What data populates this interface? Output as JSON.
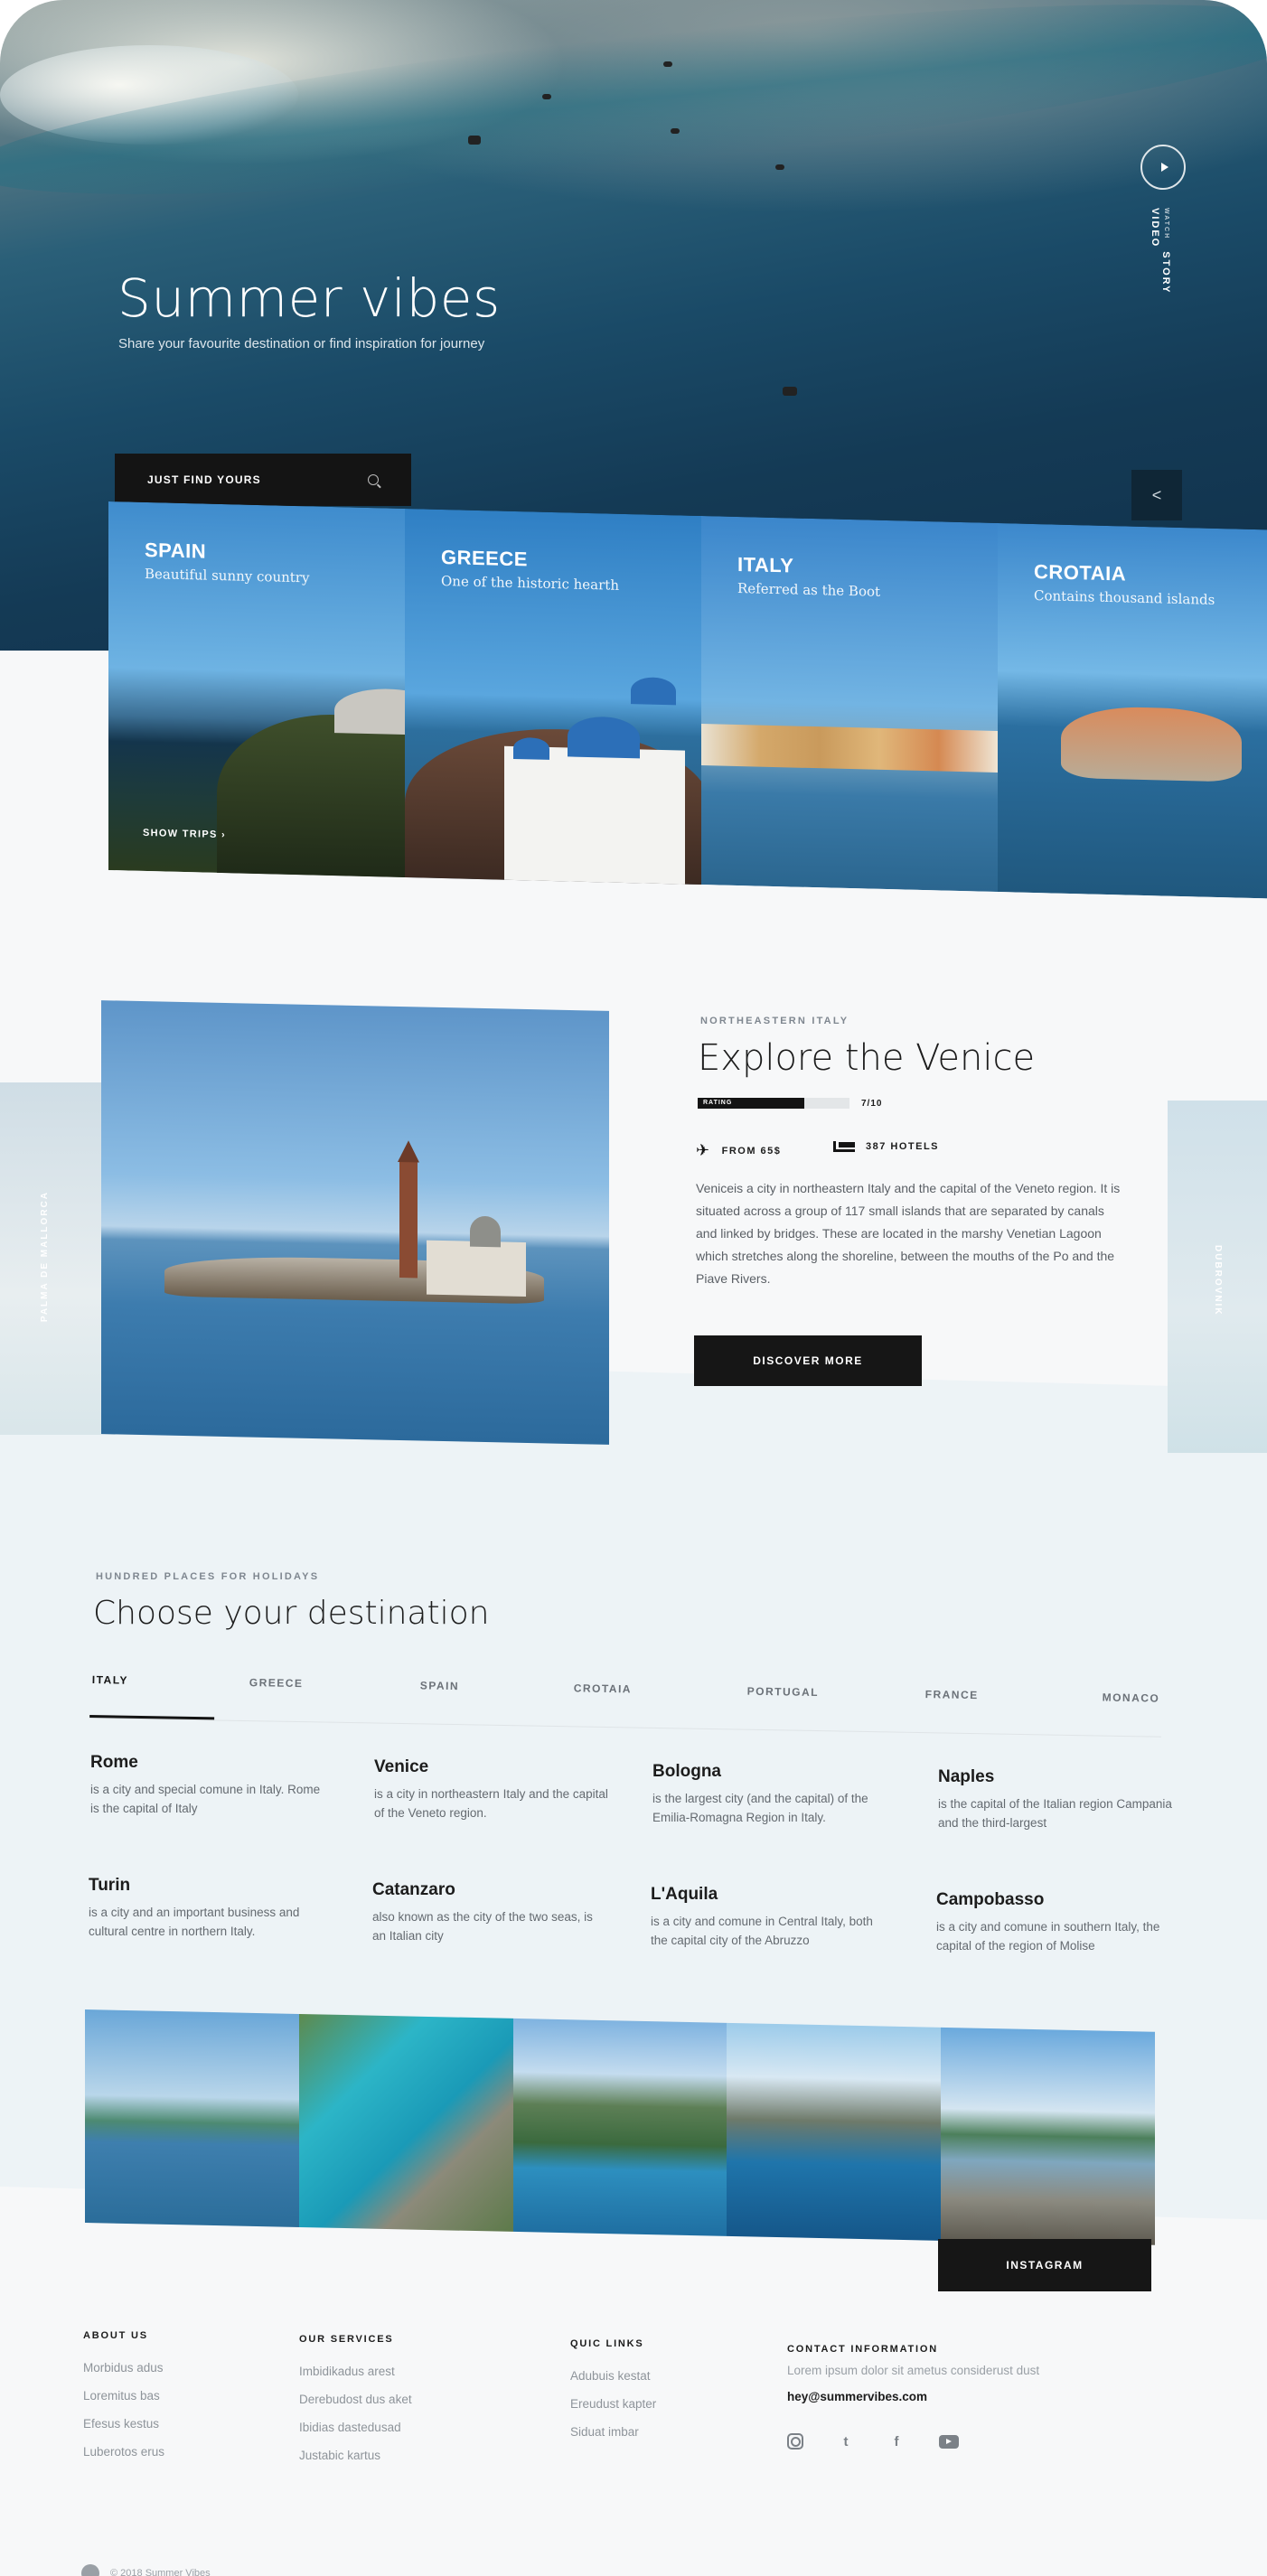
{
  "hero": {
    "title": "Summer vibes",
    "subtitle": "Share your favourite destination or find inspiration for journey",
    "story_small": "WATCH",
    "story_label": "STORY VIDEO",
    "search_label": "JUST FIND YOURS"
  },
  "cards": [
    {
      "name": "SPAIN",
      "tagline": "Beautiful sunny country",
      "action": "SHOW TRIPS"
    },
    {
      "name": "GREECE",
      "tagline": "One of the historic hearth"
    },
    {
      "name": "ITALY",
      "tagline": "Referred as the Boot"
    },
    {
      "name": "CROTAIA",
      "tagline": "Contains thousand islands"
    }
  ],
  "explore": {
    "kicker": "NORTHEASTERN ITALY",
    "title": "Explore the Venice",
    "rating_label": "RATING",
    "rating_value": "7/10",
    "rating_fraction": 0.7,
    "price": "FROM 65$",
    "hotels": "387 HOTELS",
    "body": "Veniceis a city in northeastern Italy and the capital of the Veneto region. It is situated across a group of 117 small islands that are separated by canals and linked by bridges. These are located in the marshy Venetian Lagoon which stretches along the shoreline, between the mouths of the Po and the Piave Rivers.",
    "button": "DISCOVER MORE",
    "side_left": "PALMA DE MALLORCA",
    "side_right": "DUBROVNIK"
  },
  "destinations": {
    "kicker": "HUNDRED PLACES FOR HOLIDAYS",
    "title": "Choose your destination",
    "tabs": [
      "ITALY",
      "GREECE",
      "SPAIN",
      "CROTAIA",
      "PORTUGAL",
      "FRANCE",
      "MONACO"
    ],
    "cities": [
      {
        "name": "Rome",
        "desc": "is a city and special comune in Italy. Rome is the capital of Italy"
      },
      {
        "name": "Venice",
        "desc": "is a city in northeastern Italy and the capital of the Veneto region."
      },
      {
        "name": "Bologna",
        "desc": "is the largest city (and the capital) of the Emilia-Romagna Region in Italy."
      },
      {
        "name": "Naples",
        "desc": "is the capital of the Italian region Campania and the third-largest"
      },
      {
        "name": "Turin",
        "desc": "is a city and an important business and cultural centre in northern Italy."
      },
      {
        "name": "Catanzaro",
        "desc": "also known as the city of the two seas, is an Italian city"
      },
      {
        "name": "L'Aquila",
        "desc": "is a city and comune in Central Italy, both the capital city of the Abruzzo"
      },
      {
        "name": "Campobasso",
        "desc": "is a city and comune in southern Italy, the capital of the region of Molise"
      }
    ]
  },
  "instagram": {
    "button": "INSTAGRAM"
  },
  "footer": {
    "about": {
      "title": "ABOUT US",
      "links": [
        "Morbidus adus",
        "Loremitus bas",
        "Efesus kestus",
        "Luberotos erus"
      ]
    },
    "services": {
      "title": "OUR SERVICES",
      "links": [
        "Imbidikadus arest",
        "Derebudost dus aket",
        "Ibidias dastedusad",
        "Justabic kartus"
      ]
    },
    "quick": {
      "title": "QUIC LINKS",
      "links": [
        "Adubuis kestat",
        "Ereudust kapter",
        "Siduat imbar"
      ]
    },
    "contact": {
      "title": "CONTACT INFORMATION",
      "text": "Lorem ipsum dolor sit ametus considerust dust",
      "email": "hey@summervibes.com"
    },
    "socials": [
      "instagram-icon",
      "twitter-icon",
      "facebook-icon",
      "youtube-icon"
    ],
    "copyright": "© 2018 Summer Vibes"
  }
}
